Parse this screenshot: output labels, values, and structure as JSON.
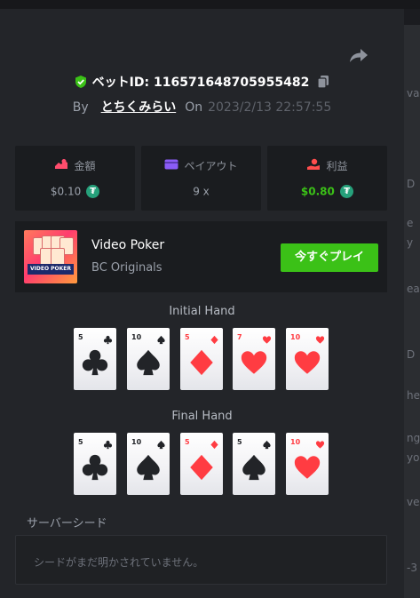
{
  "bet": {
    "id_label": "ベットID: 116571648705955482",
    "by_label": "By",
    "username": "とちくみらい",
    "on_label": "On",
    "timestamp": "2023/2/13 22:57:55"
  },
  "stats": {
    "amount": {
      "label": "金額",
      "value": "$0.10"
    },
    "payout": {
      "label": "ペイアウト",
      "value": "9 x"
    },
    "profit": {
      "label": "利益",
      "value": "$0.80"
    }
  },
  "currency_icon_glyph": "₮",
  "game": {
    "thumbnail_text": "VIDEO POKER",
    "name": "Video Poker",
    "provider": "BC Originals",
    "play_button": "今すぐプレイ"
  },
  "initial_hand": {
    "title": "Initial Hand",
    "cards": [
      {
        "rank": "5",
        "suit": "clubs",
        "color": "black"
      },
      {
        "rank": "10",
        "suit": "spades",
        "color": "black"
      },
      {
        "rank": "5",
        "suit": "diamonds",
        "color": "red"
      },
      {
        "rank": "7",
        "suit": "hearts",
        "color": "red"
      },
      {
        "rank": "10",
        "suit": "hearts",
        "color": "red"
      }
    ]
  },
  "final_hand": {
    "title": "Final Hand",
    "cards": [
      {
        "rank": "5",
        "suit": "clubs",
        "color": "black"
      },
      {
        "rank": "10",
        "suit": "spades",
        "color": "black"
      },
      {
        "rank": "5",
        "suit": "diamonds",
        "color": "red"
      },
      {
        "rank": "5",
        "suit": "spades",
        "color": "black"
      },
      {
        "rank": "10",
        "suit": "hearts",
        "color": "red"
      }
    ]
  },
  "server_seed": {
    "label": "サーバーシード",
    "placeholder": "シードがまだ明かされていません。"
  },
  "background_fragments": [
    "va",
    "D",
    "e",
    "y",
    "ea",
    "D",
    "he",
    "ng",
    "yo",
    "ve",
    "-3"
  ],
  "colors": {
    "accent_green": "#3bc117",
    "tether": "#26a17b",
    "card_red": "#ff3c42",
    "card_black": "#222428",
    "amount_icon": "#ff4d6d",
    "payout_icon": "#8b5cf6",
    "profit_icon": "#ff4d4d"
  }
}
